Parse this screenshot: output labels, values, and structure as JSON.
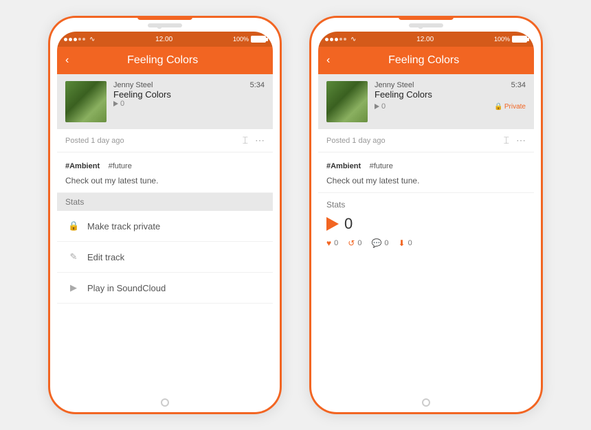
{
  "app": {
    "title": "Feeling Colors",
    "back_label": "‹"
  },
  "status_bar": {
    "dots": 5,
    "time": "12.00",
    "battery_pct": "100%"
  },
  "track": {
    "artist": "Jenny Steel",
    "name": "Feeling Colors",
    "duration": "5:34",
    "plays": "0",
    "posted": "Posted 1 day ago"
  },
  "tags": {
    "primary": "#Ambient",
    "secondary": "#future"
  },
  "description": "Check out my latest tune.",
  "stats_section": {
    "title": "Stats",
    "play_count": "0",
    "likes": "0",
    "reposts": "0",
    "comments": "0",
    "downloads": "0"
  },
  "menu_items": [
    {
      "icon": "🔒",
      "label": "Make track private"
    },
    {
      "icon": "✏",
      "label": "Edit track"
    },
    {
      "icon": "▶",
      "label": "Play in SoundCloud"
    }
  ],
  "left_phone": {
    "description_label": "Check out my latest tune.",
    "stats_partial": "Stats"
  },
  "right_phone": {
    "private_label": "Private"
  }
}
